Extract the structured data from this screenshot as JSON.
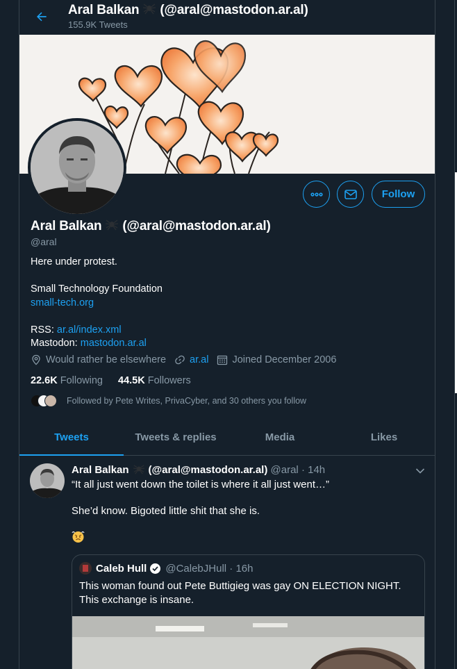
{
  "header": {
    "name": "Aral Balkan",
    "handle_suffix": "(@aral@mastodon.ar.al)",
    "tweet_count": "155.9K Tweets"
  },
  "profile": {
    "name": "Aral Balkan",
    "handle_suffix": "(@aral@mastodon.ar.al)",
    "handle": "@aral",
    "follow_label": "Follow",
    "bio": {
      "line1": "Here under protest.",
      "line2": "Small Technology Foundation",
      "link1": "small-tech.org",
      "rss_label": "RSS:",
      "rss_link": "ar.al/index.xml",
      "mastodon_label": "Mastodon:",
      "mastodon_link": "mastodon.ar.al"
    },
    "location": "Would rather be elsewhere",
    "website": "ar.al",
    "joined": "Joined December 2006",
    "following_count": "22.6K",
    "following_label": "Following",
    "followers_count": "44.5K",
    "followers_label": "Followers",
    "followed_by": "Followed by Pete Writes, PrivaCyber, and 30 others you follow"
  },
  "tabs": [
    {
      "label": "Tweets",
      "active": true
    },
    {
      "label": "Tweets & replies",
      "active": false
    },
    {
      "label": "Media",
      "active": false
    },
    {
      "label": "Likes",
      "active": false
    }
  ],
  "tweet": {
    "name": "Aral Balkan",
    "handle_suffix": "(@aral@mastodon.ar.al)",
    "handle": "@aral",
    "time": "· 14h",
    "line1": "“It all just went down the toilet is where it all just went…”",
    "line2": "She’d know. Bigoted little shit that she is.",
    "quote": {
      "name": "Caleb Hull",
      "handle": "@CalebJHull",
      "time": "· 16h",
      "text": "This woman found out Pete Buttigieg was gay ON ELECTION NIGHT. This exchange is insane."
    }
  },
  "colors": {
    "background": "#15202b",
    "accent": "#1da1f2",
    "muted": "#8899a6",
    "border": "#38444d"
  },
  "icons": [
    "back-arrow-icon",
    "spider-icon",
    "more-icon",
    "mail-icon",
    "location-icon",
    "link-icon",
    "calendar-icon",
    "chevron-down-icon",
    "verified-icon",
    "angry-face-emoji"
  ]
}
